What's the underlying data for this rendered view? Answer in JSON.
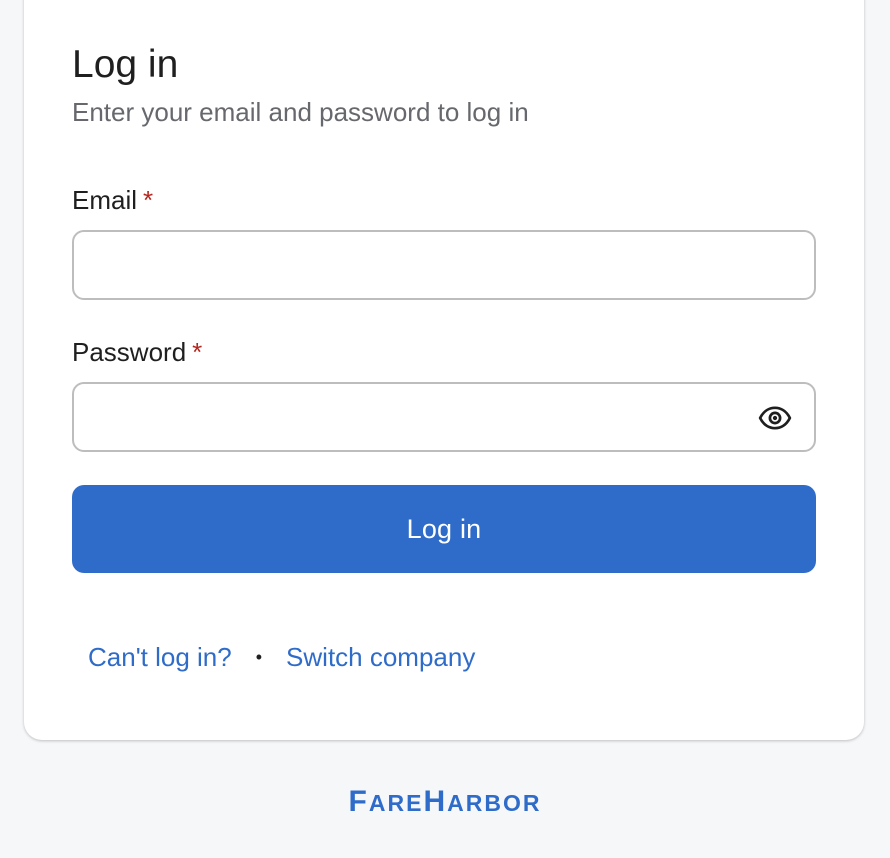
{
  "login": {
    "title": "Log in",
    "subtitle": "Enter your email and password to log in",
    "email": {
      "label": "Email",
      "required_mark": "*",
      "value": "",
      "placeholder": ""
    },
    "password": {
      "label": "Password",
      "required_mark": "*",
      "value": "",
      "placeholder": "",
      "toggle_icon": "eye-icon"
    },
    "submit_label": "Log in",
    "links": {
      "cant_login": "Can't log in?",
      "separator": "•",
      "switch_company": "Switch company"
    }
  },
  "brand": {
    "name_part1_cap": "F",
    "name_part1_rest": "ARE",
    "name_part2_cap": "H",
    "name_part2_rest": "ARBOR"
  },
  "colors": {
    "accent": "#2f6cc9",
    "required": "#b3261e",
    "background": "#f6f7f9",
    "card": "#ffffff",
    "border": "#bdbdbd"
  }
}
